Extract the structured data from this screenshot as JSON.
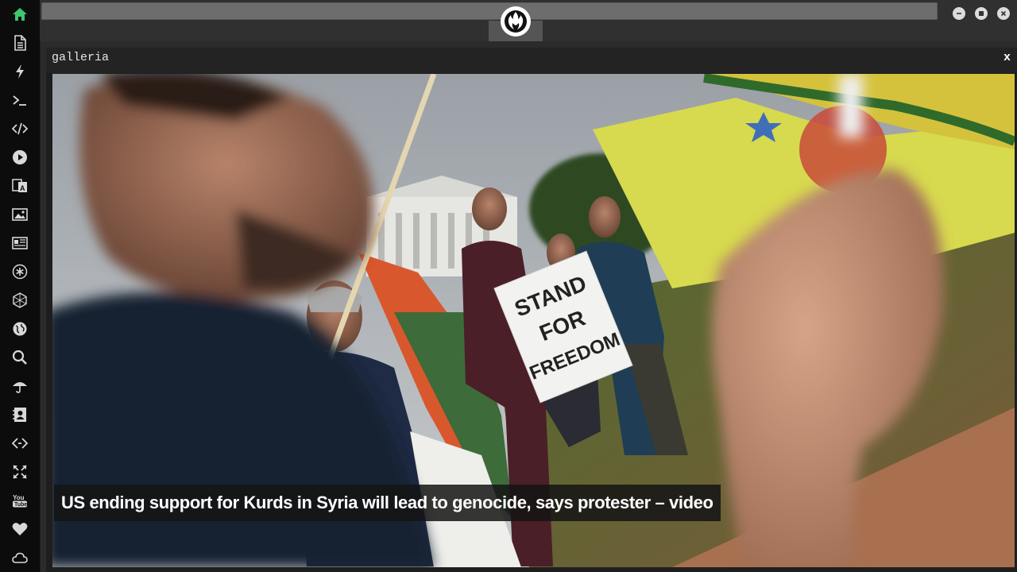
{
  "panel": {
    "title": "galleria",
    "close_label": "x"
  },
  "gallery": {
    "caption": "US ending support for Kurds in Syria will lead to genocide, says protester – video",
    "sign_text": [
      "STAND",
      "FOR",
      "FREEDOM"
    ]
  },
  "sidebar": {
    "items": [
      {
        "icon": "home-icon",
        "active": true
      },
      {
        "icon": "document-icon"
      },
      {
        "icon": "lightning-icon"
      },
      {
        "icon": "terminal-icon"
      },
      {
        "icon": "code-icon"
      },
      {
        "icon": "play-icon"
      },
      {
        "icon": "translate-icon"
      },
      {
        "icon": "image-icon"
      },
      {
        "icon": "news-icon"
      },
      {
        "icon": "asterisk-icon"
      },
      {
        "icon": "hexagon-icon"
      },
      {
        "icon": "globe-icon"
      },
      {
        "icon": "search-icon"
      },
      {
        "icon": "umbrella-icon"
      },
      {
        "icon": "contact-icon"
      },
      {
        "icon": "embed-icon"
      },
      {
        "icon": "expand-icon"
      },
      {
        "icon": "youtube-icon"
      },
      {
        "icon": "heart-icon"
      },
      {
        "icon": "cloud-icon"
      }
    ]
  },
  "colors": {
    "accent": "#3ec76b",
    "sidebar_bg": "#0c0c0c",
    "topbar_bg": "#303030",
    "panel_bg": "#1e1e1e"
  }
}
